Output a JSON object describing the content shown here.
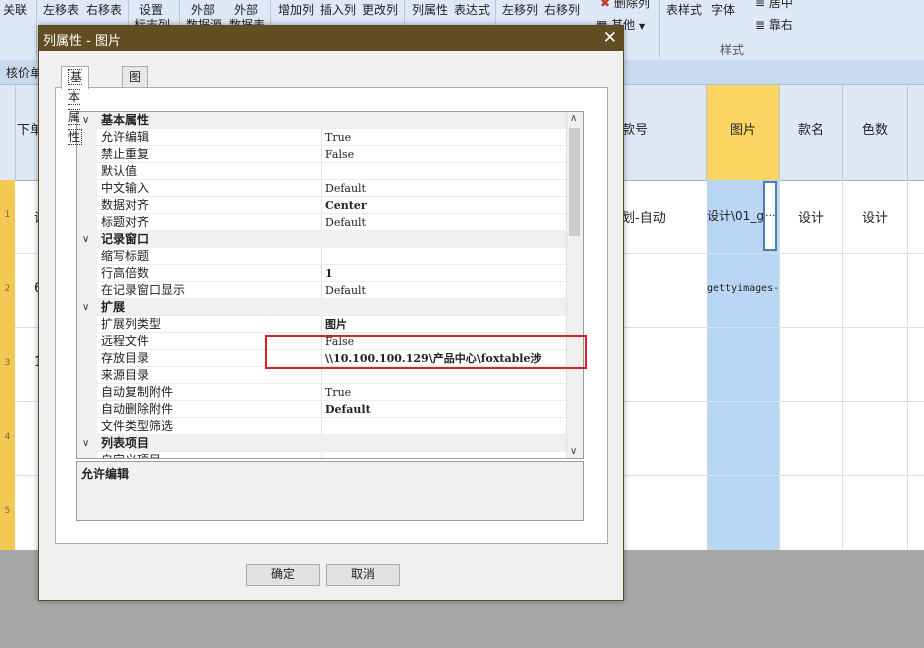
{
  "ribbon": {
    "items": [
      "关联",
      "左移表",
      "右移表",
      "设置",
      "标志列",
      "外部",
      "数据源",
      "外部",
      "数据表",
      "增加列",
      "插入列",
      "更改列",
      "列属性",
      "表达式",
      "左移列",
      "右移列",
      "删除列",
      "其他",
      "表样式",
      "字体",
      "居中",
      "靠右"
    ],
    "group_label": "样式"
  },
  "background_table": {
    "doc_tab": "核价单",
    "headers": [
      "下单",
      "",
      "款号",
      "图片",
      "款名",
      "色数"
    ],
    "cells": {
      "row1_col1": "设",
      "row1_code": "划-自动",
      "row1_img": "设计\\01_g",
      "row1_ellipsis": "...",
      "row1_name": "设计",
      "row1_colors": "设计",
      "row2_col1": "6",
      "row2_img": "gettyimages-",
      "row3_col1": "1"
    },
    "row_numbers": [
      "1",
      "2",
      "3",
      "4",
      "5"
    ]
  },
  "dialog": {
    "title": "列属性 - 图片",
    "close_glyph": "✕",
    "tabs": [
      "基本属性",
      "图片字典"
    ],
    "categories": [
      {
        "label": "基本属性",
        "props": [
          {
            "name": "允许编辑",
            "value": "True",
            "bold": false
          },
          {
            "name": "禁止重复",
            "value": "False",
            "bold": false
          },
          {
            "name": "默认值",
            "value": "",
            "bold": false
          },
          {
            "name": "中文输入",
            "value": "Default",
            "bold": false
          },
          {
            "name": "数据对齐",
            "value": "Center",
            "bold": true
          },
          {
            "name": "标题对齐",
            "value": "Default",
            "bold": false
          }
        ]
      },
      {
        "label": "记录窗口",
        "props": [
          {
            "name": "缩写标题",
            "value": "",
            "bold": false
          },
          {
            "name": "行高倍数",
            "value": "1",
            "bold": true
          },
          {
            "name": "在记录窗口显示",
            "value": "Default",
            "bold": false
          }
        ]
      },
      {
        "label": "扩展",
        "props": [
          {
            "name": "扩展列类型",
            "value": "图片",
            "bold": true
          },
          {
            "name": "远程文件",
            "value": "False",
            "bold": false
          },
          {
            "name": "存放目录",
            "value": "\\\\10.100.100.129\\产品中心\\foxtable涉",
            "bold": true
          },
          {
            "name": "来源目录",
            "value": "",
            "bold": false
          },
          {
            "name": "自动复制附件",
            "value": "True",
            "bold": false
          },
          {
            "name": "自动删除附件",
            "value": "Default",
            "bold": true
          },
          {
            "name": "文件类型筛选",
            "value": "",
            "bold": false
          }
        ]
      },
      {
        "label": "列表项目",
        "props": [
          {
            "name": "自定义项目",
            "value": "",
            "bold": false
          }
        ]
      }
    ],
    "description_title": "允许编辑",
    "ok_label": "确定",
    "cancel_label": "取消"
  },
  "colors": {
    "dialog_title_bg": "#624e23",
    "highlight_border": "#d6232a",
    "row_gutter": "#f3c853",
    "image_column": "#b9d6f5"
  }
}
